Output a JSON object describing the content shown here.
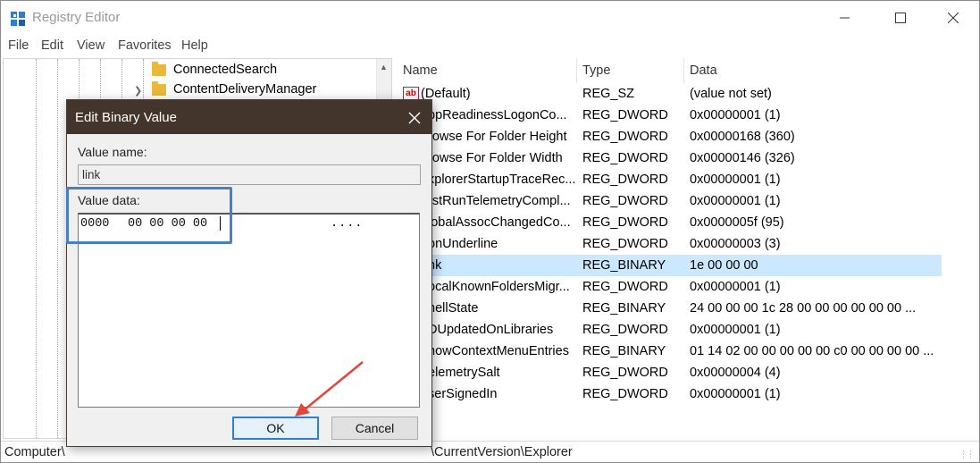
{
  "window": {
    "title": "Registry Editor"
  },
  "menu": [
    "File",
    "Edit",
    "View",
    "Favorites",
    "Help"
  ],
  "tree": {
    "items": [
      {
        "label": "ConnectedSearch"
      },
      {
        "label": "ContentDeliveryManager"
      }
    ]
  },
  "list": {
    "columns": [
      "Name",
      "Type",
      "Data"
    ],
    "rows": [
      {
        "name": "(Default)",
        "type": "REG_SZ",
        "data": "(value not set)"
      },
      {
        "name": "ppReadinessLogonCo...",
        "type": "REG_DWORD",
        "data": "0x00000001 (1)"
      },
      {
        "name": "rowse For Folder Height",
        "type": "REG_DWORD",
        "data": "0x00000168 (360)"
      },
      {
        "name": "rowse For Folder Width",
        "type": "REG_DWORD",
        "data": "0x00000146 (326)"
      },
      {
        "name": "xplorerStartupTraceRec...",
        "type": "REG_DWORD",
        "data": "0x00000001 (1)"
      },
      {
        "name": "rstRunTelemetryCompl...",
        "type": "REG_DWORD",
        "data": "0x00000001 (1)"
      },
      {
        "name": "lobalAssocChangedCo...",
        "type": "REG_DWORD",
        "data": "0x0000005f (95)"
      },
      {
        "name": "onUnderline",
        "type": "REG_DWORD",
        "data": "0x00000003 (3)"
      },
      {
        "name": "nk",
        "type": "REG_BINARY",
        "data": "1e 00 00 00"
      },
      {
        "name": "ocalKnownFoldersMigr...",
        "type": "REG_DWORD",
        "data": "0x00000001 (1)"
      },
      {
        "name": "hellState",
        "type": "REG_BINARY",
        "data": "24 00 00 00 1c 28 00 00 00 00 00 00 ..."
      },
      {
        "name": "DUpdatedOnLibraries",
        "type": "REG_DWORD",
        "data": "0x00000001 (1)"
      },
      {
        "name": "howContextMenuEntries",
        "type": "REG_BINARY",
        "data": "01 14 02 00 00 00 00 00 c0 00 00 00 00 ..."
      },
      {
        "name": "elemetrySalt",
        "type": "REG_DWORD",
        "data": "0x00000004 (4)"
      },
      {
        "name": "serSignedIn",
        "type": "REG_DWORD",
        "data": "0x00000001 (1)"
      }
    ],
    "selected_index": 8
  },
  "status": {
    "path_start": "Computer\\",
    "path_end": "\\CurrentVersion\\Explorer"
  },
  "dialog": {
    "title": "Edit Binary Value",
    "value_name_label": "Value name:",
    "value_name": "link",
    "value_data_label": "Value data:",
    "hex_offset": "0000",
    "hex_bytes": "00 00 00 00",
    "ascii": "....",
    "ok_label": "OK",
    "cancel_label": "Cancel"
  },
  "colors": {
    "dialog_title_bg": "#43342c",
    "highlight": "#4a7ec9",
    "arrow": "#e0463a",
    "selected_row": "#cce8ff"
  }
}
